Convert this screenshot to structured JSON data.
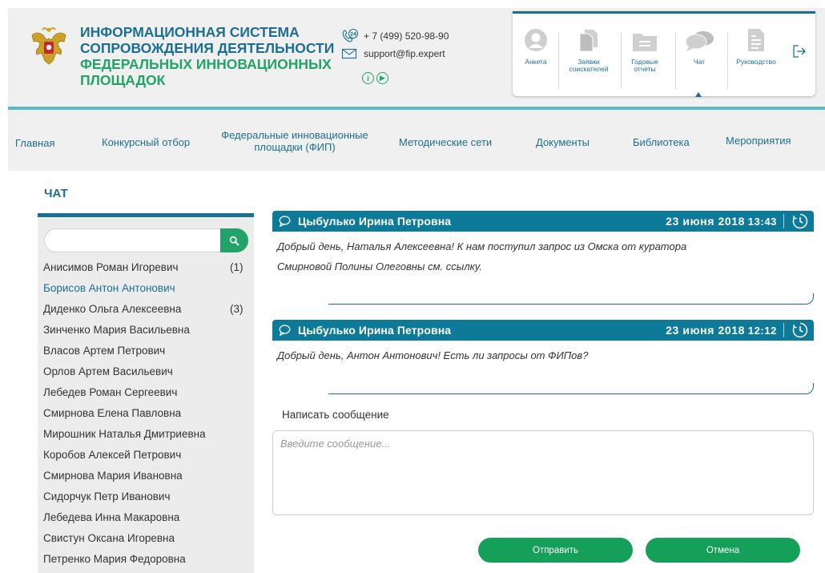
{
  "header": {
    "title_line1": "ИНФОРМАЦИОННАЯ СИСТЕМА",
    "title_line2": "СОПРОВОЖДЕНИЯ ДЕЯТЕЛЬНОСТИ",
    "title_line3": "ФЕДЕРАЛЬНЫХ ИННОВАЦИОННЫХ",
    "title_line4": "ПЛОЩАДОК",
    "phone": "+ 7 (499) 520-98-90",
    "email": "support@fip.expert",
    "icons": [
      "emblem-icon",
      "phone-24-icon",
      "mail-icon",
      "info-icon",
      "play-icon"
    ]
  },
  "user_panel": {
    "items": [
      {
        "label": "Анкета",
        "icon": "user-avatar-icon"
      },
      {
        "label": "Заявки соискателей",
        "icon": "documents-icon"
      },
      {
        "label": "Годовые отчеты",
        "icon": "folder-icon"
      },
      {
        "label": "Чат",
        "icon": "chat-icon"
      },
      {
        "label": "Руководство",
        "icon": "manual-icon"
      }
    ],
    "logout_icon": "logout-icon"
  },
  "nav": {
    "items": [
      "Главная",
      "Конкурсный отбор",
      "Федеральные инновационные",
      "площадки (ФИП)",
      "Методические сети",
      "Документы",
      "Библиотека",
      "Мероприятия"
    ]
  },
  "page": {
    "title": "ЧАТ"
  },
  "sidebar": {
    "search_placeholder": "",
    "contacts": [
      {
        "name": "Анисимов Роман Игоревич",
        "count": "(1)"
      },
      {
        "name": "Борисов Антон Антонович",
        "count": ""
      },
      {
        "name": "Диденко Ольга Алексеевна",
        "count": "(3)"
      },
      {
        "name": "Зинченко Мария Васильевна",
        "count": ""
      },
      {
        "name": "Власов Артем Петрович",
        "count": ""
      },
      {
        "name": "Орлов Артем Васильевич",
        "count": ""
      },
      {
        "name": "Лебедев Роман Сергеевич",
        "count": ""
      },
      {
        "name": "Смирнова Елена Павловна",
        "count": ""
      },
      {
        "name": "Мирошник Наталья Дмитриевна",
        "count": ""
      },
      {
        "name": "Коробов Алексей Петрович",
        "count": ""
      },
      {
        "name": "Смирнова Мария Ивановна",
        "count": ""
      },
      {
        "name": "Сидорчук Петр Иванович",
        "count": ""
      },
      {
        "name": "Лебедева Инна Макаровна",
        "count": ""
      },
      {
        "name": "Свистун Оксана Игоревна",
        "count": ""
      },
      {
        "name": "Петренко Мария Федоровна",
        "count": ""
      }
    ]
  },
  "messages": [
    {
      "author": "Цыбулько Ирина Петровна",
      "date": "23 июня 2018",
      "time": "13:43",
      "line1": "Добрый день, Наталья Алексеевна! К нам поступил запрос из Омска от куратора",
      "line2": "Смирновой Полины Олеговны см. ссылку."
    },
    {
      "author": "Цыбулько Ирина Петровна",
      "date": "23 июня 2018",
      "time": "12:12",
      "line1": "Добрый день, Антон Антонович! Есть ли запросы от ФИПов?",
      "line2": ""
    }
  ],
  "compose": {
    "label": "Написать сообщение",
    "placeholder": "Введите сообщение...",
    "send_label": "Отправить",
    "cancel_label": "Отмена"
  },
  "colors": {
    "brand_blue": "#1d6f91",
    "brand_green": "#22a36a",
    "message_header": "#0d7a99",
    "button_green": "#15a05a",
    "panel_gray": "#f0f0f0"
  }
}
